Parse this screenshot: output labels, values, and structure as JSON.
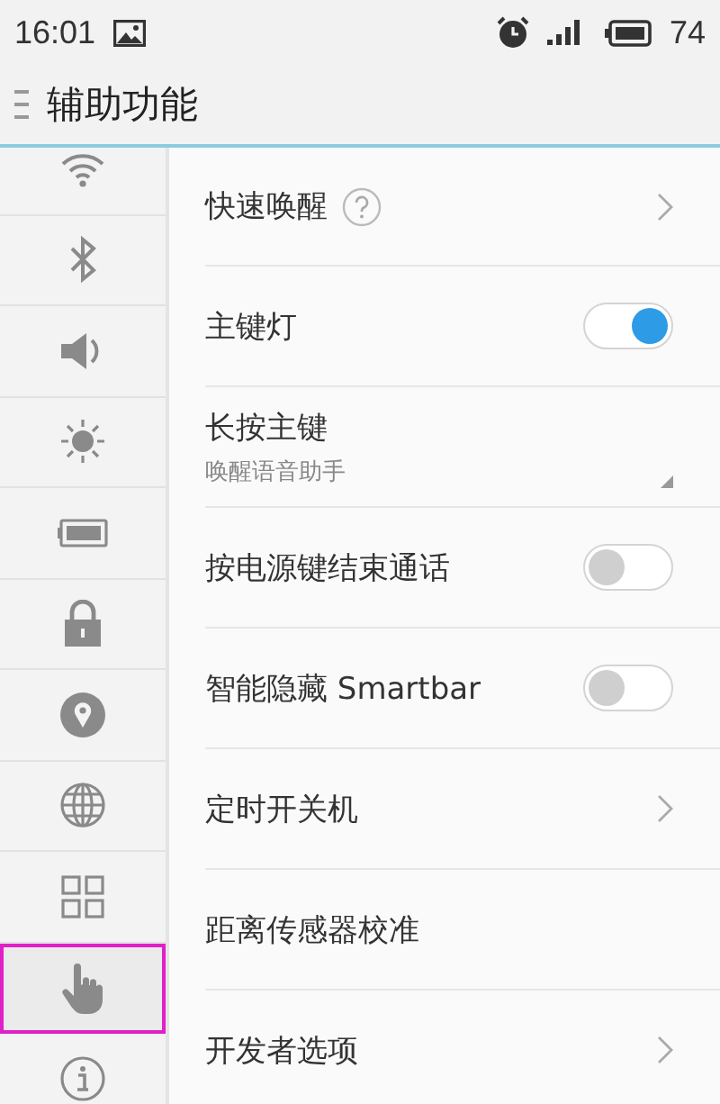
{
  "status_bar": {
    "time": "16:01",
    "battery": "74"
  },
  "header": {
    "title": "辅助功能"
  },
  "sidebar": {
    "items": [
      {
        "kind": "wifi",
        "selected": false
      },
      {
        "kind": "bluetooth",
        "selected": false
      },
      {
        "kind": "sound",
        "selected": false
      },
      {
        "kind": "brightness",
        "selected": false
      },
      {
        "kind": "battery",
        "selected": false
      },
      {
        "kind": "lock",
        "selected": false
      },
      {
        "kind": "location",
        "selected": false
      },
      {
        "kind": "globe",
        "selected": false
      },
      {
        "kind": "apps",
        "selected": false
      },
      {
        "kind": "hand",
        "selected": true
      },
      {
        "kind": "info",
        "selected": false
      }
    ]
  },
  "settings": [
    {
      "kind": "link",
      "label": "快速唤醒",
      "help": true
    },
    {
      "kind": "toggle",
      "label": "主键灯",
      "on": true
    },
    {
      "kind": "dropdown",
      "label": "长按主键",
      "value": "唤醒语音助手"
    },
    {
      "kind": "toggle",
      "label": "按电源键结束通话",
      "on": false
    },
    {
      "kind": "toggle",
      "label": "智能隐藏 Smartbar",
      "on": false
    },
    {
      "kind": "link",
      "label": "定时开关机"
    },
    {
      "kind": "plain",
      "label": "距离传感器校准"
    },
    {
      "kind": "link",
      "label": "开发者选项"
    }
  ]
}
